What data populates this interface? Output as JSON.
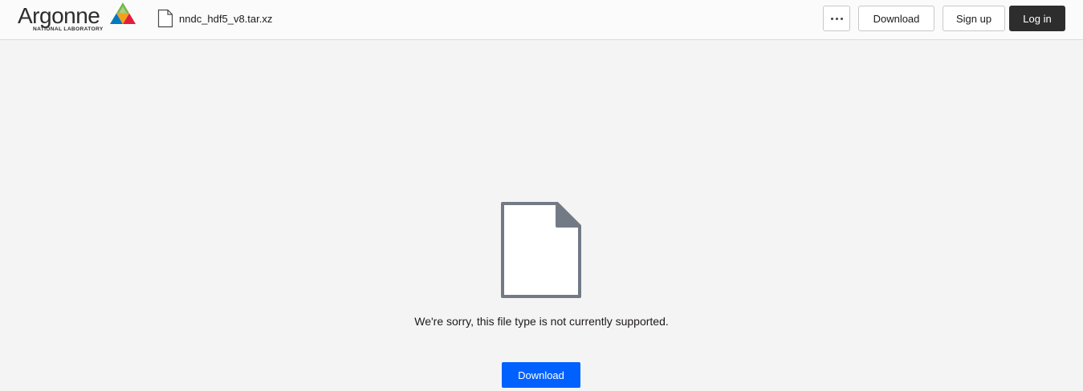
{
  "header": {
    "logo": {
      "wordmark": "Argonne",
      "subtitle": "NATIONAL LABORATORY",
      "icon": "argonne-triangle-logo"
    },
    "file": {
      "icon": "file-icon",
      "name": "nndc_hdf5_v8.tar.xz"
    },
    "actions": {
      "more_icon": "more-horizontal-icon",
      "download_label": "Download",
      "signup_label": "Sign up",
      "login_label": "Log in"
    }
  },
  "preview": {
    "icon": "generic-file-icon",
    "message": "We're sorry, this file type is not currently supported.",
    "download_label": "Download"
  },
  "colors": {
    "primary": "#0061fe",
    "dark_button": "#2d2d2d",
    "background": "#f4f4f4",
    "file_icon_stroke": "#727b85"
  }
}
